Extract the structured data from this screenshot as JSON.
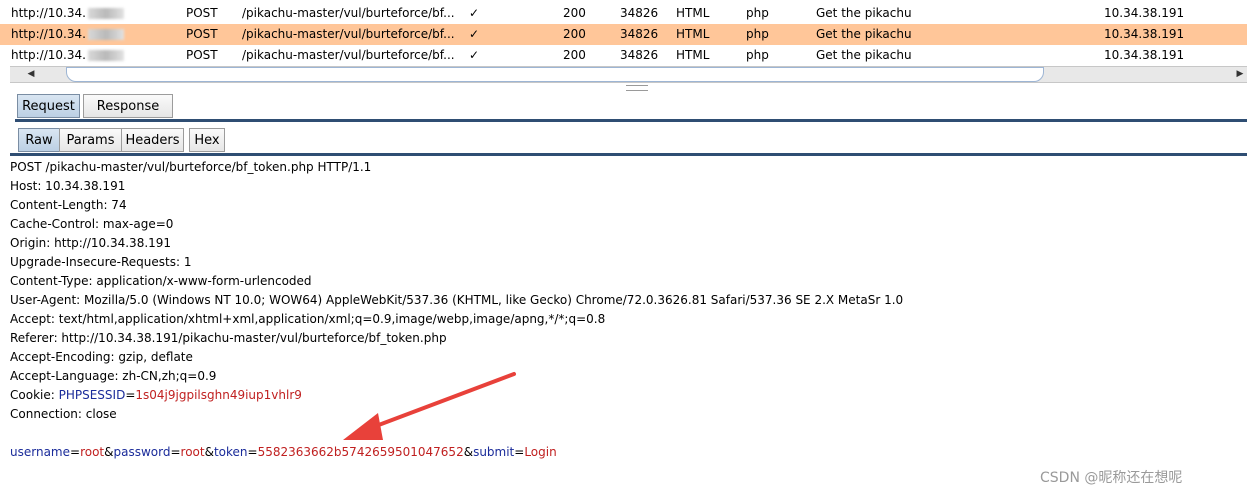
{
  "history": [
    {
      "host": "http://10.34.",
      "method": "POST",
      "url": "/pikachu-master/vul/burteforce/bf...",
      "check": "✓",
      "status": "200",
      "length": "34826",
      "mime": "HTML",
      "ext": "php",
      "title": "Get the pikachu",
      "ip": "10.34.38.191",
      "selected": false
    },
    {
      "host": "http://10.34.",
      "method": "POST",
      "url": "/pikachu-master/vul/burteforce/bf...",
      "check": "✓",
      "status": "200",
      "length": "34826",
      "mime": "HTML",
      "ext": "php",
      "title": "Get the pikachu",
      "ip": "10.34.38.191",
      "selected": true
    },
    {
      "host": "http://10.34.",
      "method": "POST",
      "url": "/pikachu-master/vul/burteforce/bf...",
      "check": "✓",
      "status": "200",
      "length": "34826",
      "mime": "HTML",
      "ext": "php",
      "title": "Get the pikachu",
      "ip": "10.34.38.191",
      "selected": false
    }
  ],
  "scrollbar": {
    "left_icon": "arrow-left-icon",
    "right_icon": "arrow-right-icon"
  },
  "tabs_main": {
    "request": "Request",
    "response": "Response"
  },
  "tabs_view": {
    "raw": "Raw",
    "params": "Params",
    "headers": "Headers",
    "hex": "Hex"
  },
  "request": {
    "request_line": "POST /pikachu-master/vul/burteforce/bf_token.php HTTP/1.1",
    "host": "Host: 10.34.38.191",
    "content_length": "Content-Length: 74",
    "cache_control": "Cache-Control: max-age=0",
    "origin": "Origin: http://10.34.38.191",
    "upgrade": "Upgrade-Insecure-Requests: 1",
    "content_type": "Content-Type: application/x-www-form-urlencoded",
    "user_agent": "User-Agent: Mozilla/5.0 (Windows NT 10.0; WOW64) AppleWebKit/537.36 (KHTML, like Gecko) Chrome/72.0.3626.81 Safari/537.36 SE 2.X MetaSr 1.0",
    "accept": "Accept: text/html,application/xhtml+xml,application/xml;q=0.9,image/webp,image/apng,*/*;q=0.8",
    "referer": "Referer: http://10.34.38.191/pikachu-master/vul/burteforce/bf_token.php",
    "accept_encoding": "Accept-Encoding: gzip, deflate",
    "accept_language": "Accept-Language: zh-CN,zh;q=0.9",
    "cookie_label": "Cookie: ",
    "cookie_key": "PHPSESSID",
    "cookie_value": "1s04j9jgpilsghn49iup1vhlr9",
    "connection": "Connection: close",
    "body": [
      {
        "key": "username",
        "value": "root"
      },
      {
        "key": "password",
        "value": "root"
      },
      {
        "key": "token",
        "value": "5582363662b5742659501047652"
      },
      {
        "key": "submit",
        "value": "Login"
      }
    ]
  },
  "annotation": {
    "arrow_color": "#e8413a"
  },
  "watermark": "CSDN @昵称还在想呢",
  "colors": {
    "selected_row": "#ffc699",
    "param_key": "#1a2b9a",
    "param_value": "#c02020",
    "tab_line": "#2f4e73"
  }
}
